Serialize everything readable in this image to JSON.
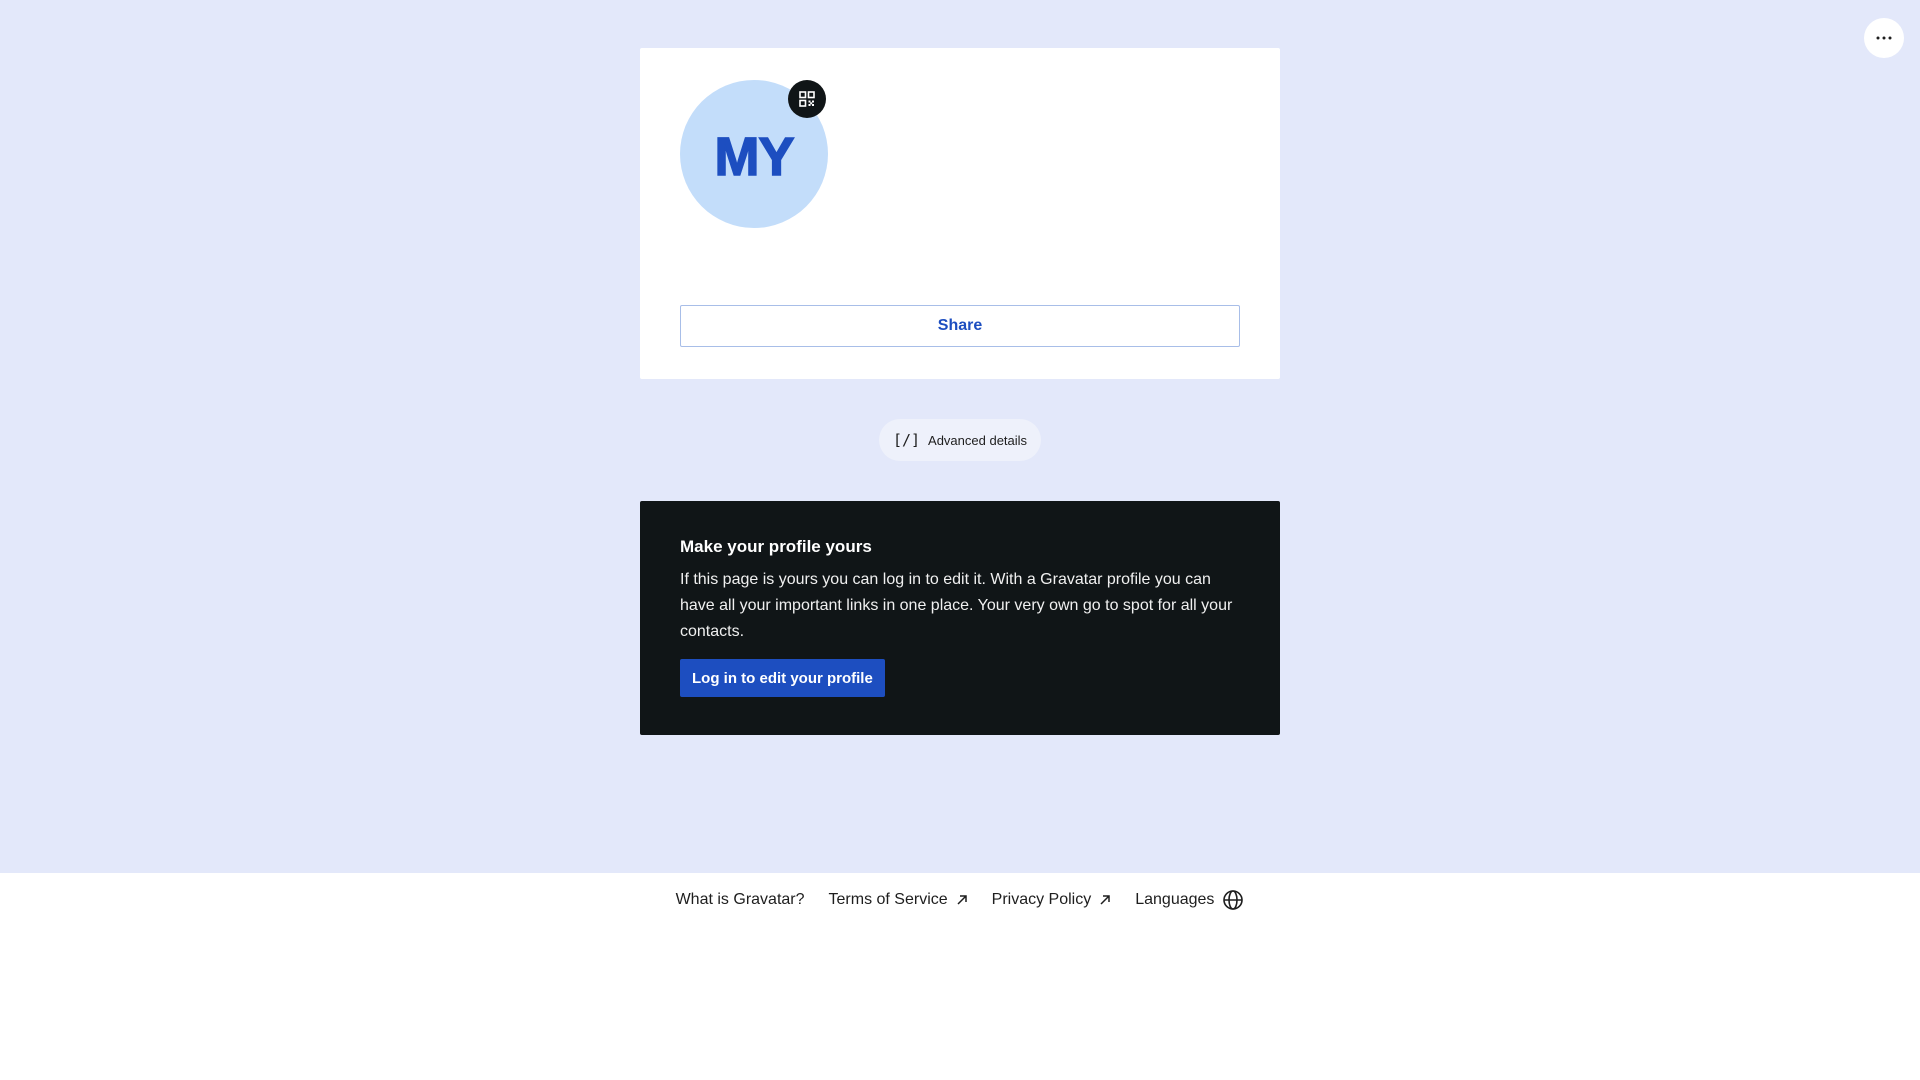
{
  "header": {
    "more_icon": "ellipsis-icon"
  },
  "profile": {
    "initials": "MY",
    "avatar_color": "#c3ddfa",
    "initials_color": "#1d4ec0",
    "qr_icon": "qr-code-icon",
    "share_label": "Share"
  },
  "advanced": {
    "icon": "[/]",
    "label": "Advanced details"
  },
  "promo": {
    "title": "Make your profile yours",
    "text": "If this page is yours you can log in to edit it. With a Gravatar profile you can have all your important links in one place. Your very own go to spot for all your contacts.",
    "button_label": "Log in to edit your profile",
    "background": "#101517",
    "button_color": "#1d4ec0"
  },
  "footer": {
    "links": [
      {
        "label": "What is Gravatar?",
        "icon": ""
      },
      {
        "label": "Terms of Service",
        "icon": "external-link-icon"
      },
      {
        "label": "Privacy Policy",
        "icon": "external-link-icon"
      },
      {
        "label": "Languages",
        "icon": "globe-icon"
      }
    ]
  },
  "colors": {
    "page_background": "#e3e8fa",
    "accent": "#1d4ec0"
  }
}
